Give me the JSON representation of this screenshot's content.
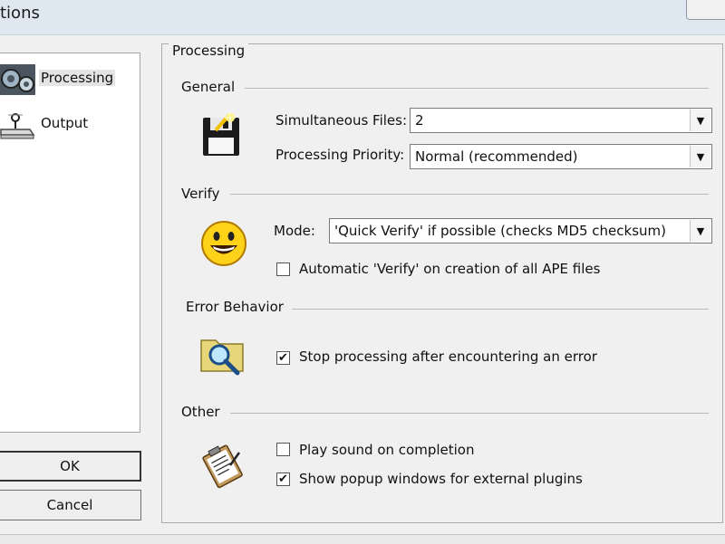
{
  "window": {
    "title_fragment": "tions"
  },
  "nav": {
    "items": [
      {
        "label": "Processing",
        "icon": "gears-icon",
        "selected": true
      },
      {
        "label": "Output",
        "icon": "drive-icon",
        "selected": false
      }
    ],
    "ok_label": "OK",
    "cancel_label": "Cancel"
  },
  "panel": {
    "title": "Processing",
    "general": {
      "heading": "General",
      "simultaneous_label": "Simultaneous Files:",
      "simultaneous_value": "2",
      "priority_label": "Processing Priority:",
      "priority_value": "Normal (recommended)"
    },
    "verify": {
      "heading": "Verify",
      "mode_label": "Mode:",
      "mode_value": "'Quick Verify' if possible (checks MD5 checksum)",
      "auto_verify_label": "Automatic 'Verify' on creation of all APE files",
      "auto_verify_checked": false
    },
    "error": {
      "heading": "Error Behavior",
      "stop_label": "Stop processing after encountering an error",
      "stop_checked": true
    },
    "other": {
      "heading": "Other",
      "sound_label": "Play sound on completion",
      "sound_checked": false,
      "popup_label": "Show popup windows for external plugins",
      "popup_checked": true
    }
  },
  "glyphs": {
    "check": "✔",
    "dropdown": "▼"
  }
}
